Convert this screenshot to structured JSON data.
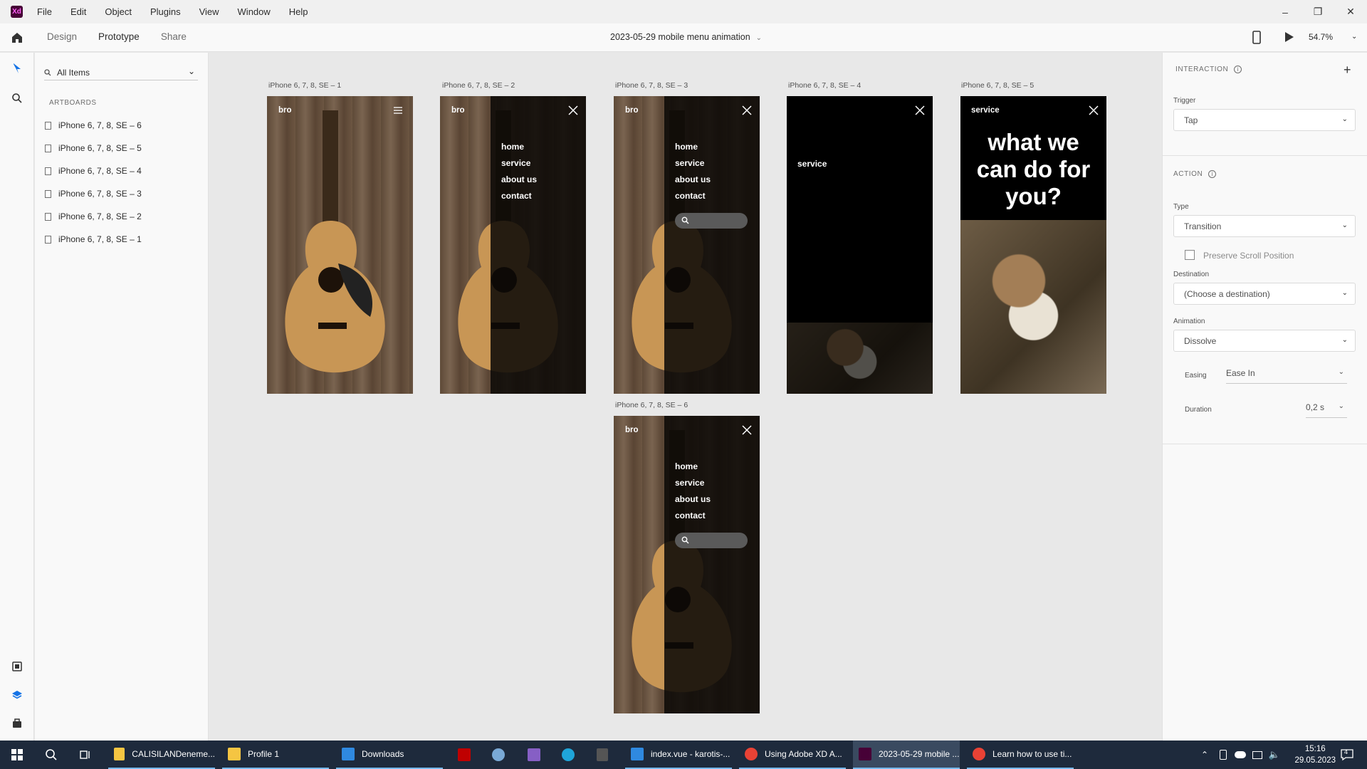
{
  "window": {
    "app_badge": "Xd",
    "menu": [
      "File",
      "Edit",
      "Object",
      "Plugins",
      "View",
      "Window",
      "Help"
    ],
    "controls": {
      "minimize": "–",
      "restore": "❐",
      "close": "✕"
    }
  },
  "toolbar": {
    "tabs": [
      "Design",
      "Prototype",
      "Share"
    ],
    "active_tab": "Prototype",
    "doc_title": "2023-05-29 mobile menu animation",
    "zoom": "54.7%"
  },
  "layers": {
    "filter": "All Items",
    "section_title": "ARTBOARDS",
    "artboards": [
      "iPhone 6, 7, 8, SE – 6",
      "iPhone 6, 7, 8, SE – 5",
      "iPhone 6, 7, 8, SE – 4",
      "iPhone 6, 7, 8, SE – 3",
      "iPhone 6, 7, 8, SE – 2",
      "iPhone 6, 7, 8, SE – 1"
    ]
  },
  "canvas": {
    "boards": [
      {
        "label": "iPhone 6, 7, 8, SE – 1",
        "brand": "bro"
      },
      {
        "label": "iPhone 6, 7, 8, SE – 2",
        "brand": "bro",
        "nav": [
          "home",
          "service",
          "about us",
          "contact"
        ]
      },
      {
        "label": "iPhone 6, 7, 8, SE – 3",
        "brand": "bro",
        "nav": [
          "home",
          "service",
          "about us",
          "contact"
        ]
      },
      {
        "label": "iPhone 6, 7, 8, SE – 4",
        "heading": "service"
      },
      {
        "label": "iPhone 6, 7, 8, SE – 5",
        "brand": "service",
        "headline_lines": [
          "what we",
          "can do for",
          "you?"
        ]
      },
      {
        "label": "iPhone 6, 7, 8, SE – 6",
        "brand": "bro",
        "nav": [
          "home",
          "service",
          "about us",
          "contact"
        ]
      }
    ]
  },
  "properties": {
    "interaction_title": "INTERACTION",
    "trigger_label": "Trigger",
    "trigger_value": "Tap",
    "action_title": "ACTION",
    "type_label": "Type",
    "type_value": "Transition",
    "preserve_scroll_label": "Preserve Scroll Position",
    "destination_label": "Destination",
    "destination_value": "(Choose a destination)",
    "animation_label": "Animation",
    "animation_value": "Dissolve",
    "easing_label": "Easing",
    "easing_value": "Ease In",
    "duration_label": "Duration",
    "duration_value": "0,2 s"
  },
  "taskbar": {
    "apps": [
      {
        "title": "CALISILANDeneme...",
        "color": "#f5c542"
      },
      {
        "title": "Profile 1",
        "color": "#f5c542"
      },
      {
        "title": "Downloads",
        "color": "#2f89e0"
      },
      {
        "title": "index.vue - karotis-...",
        "color": "#2f89e0"
      },
      {
        "title": "Using Adobe XD A...",
        "color": "#e94235"
      },
      {
        "title": "2023-05-29 mobile ...",
        "color": "#470137"
      },
      {
        "title": "Learn how to use ti...",
        "color": "#e94235"
      }
    ],
    "time": "15:16",
    "date": "29.05.2023",
    "notifications": "4"
  }
}
